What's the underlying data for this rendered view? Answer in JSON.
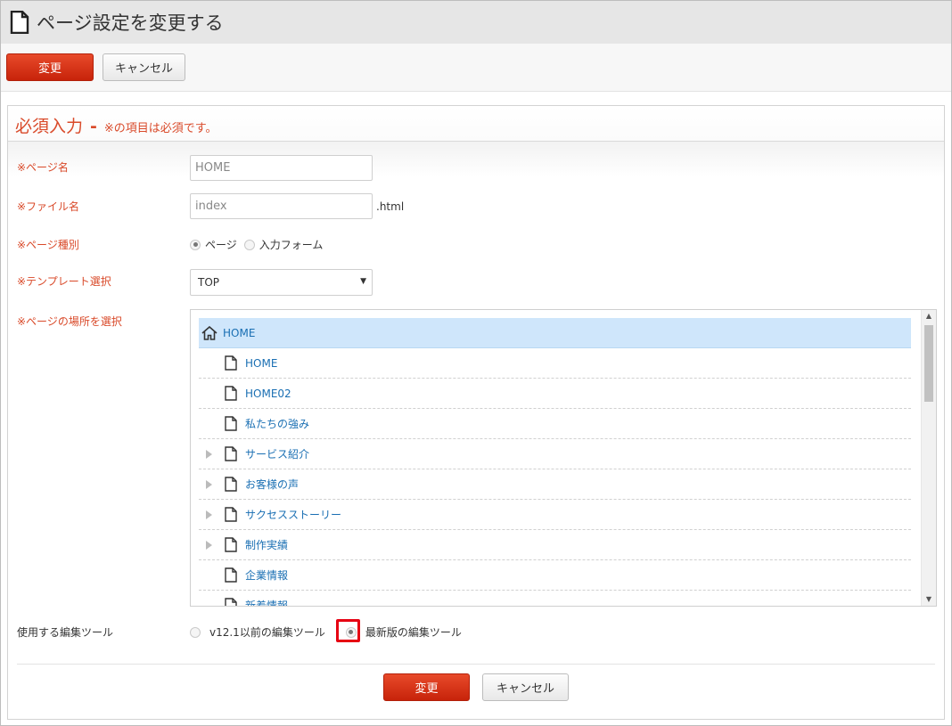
{
  "header": {
    "title": "ページ設定を変更する"
  },
  "toolbar": {
    "submit_label": "変更",
    "cancel_label": "キャンセル"
  },
  "panel": {
    "heading": "必須入力",
    "dash": "-",
    "note": "※の項目は必須です。"
  },
  "form": {
    "page_name": {
      "label": "※ページ名",
      "value": "HOME"
    },
    "file_name": {
      "label": "※ファイル名",
      "value": "index",
      "suffix": ".html"
    },
    "page_type": {
      "label": "※ページ種別",
      "options": [
        "ページ",
        "入力フォーム"
      ],
      "selected": "ページ"
    },
    "template": {
      "label": "※テンプレート選択",
      "value": "TOP"
    },
    "location": {
      "label": "※ページの場所を選択"
    },
    "editor": {
      "label": "使用する編集ツール",
      "options": [
        "v12.1以前の編集ツール",
        "最新版の編集ツール"
      ],
      "selected": "最新版の編集ツール"
    }
  },
  "tree": {
    "root": "HOME",
    "items": [
      {
        "label": "HOME",
        "expandable": false
      },
      {
        "label": "HOME02",
        "expandable": false
      },
      {
        "label": "私たちの強み",
        "expandable": false
      },
      {
        "label": "サービス紹介",
        "expandable": true
      },
      {
        "label": "お客様の声",
        "expandable": true
      },
      {
        "label": "サクセスストーリー",
        "expandable": true
      },
      {
        "label": "制作実績",
        "expandable": true
      },
      {
        "label": "企業情報",
        "expandable": false
      },
      {
        "label": "新着情報",
        "expandable": false
      }
    ]
  },
  "footer": {
    "submit_label": "変更",
    "cancel_label": "キャンセル"
  },
  "colors": {
    "accent_red": "#d94a2a",
    "button_red": "#c7230a",
    "tree_link": "#1a6fb3",
    "selection": "#cfe6fb",
    "highlight": "#e60012"
  }
}
